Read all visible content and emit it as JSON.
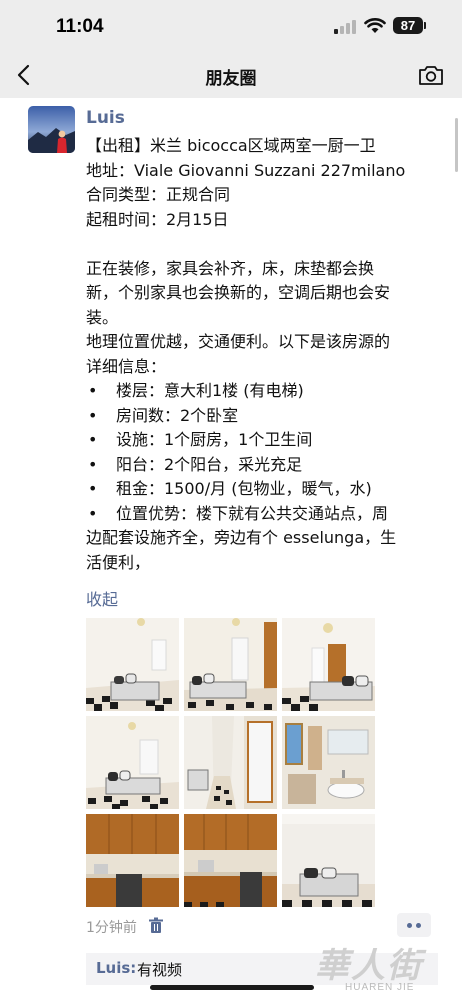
{
  "status": {
    "time": "11:04",
    "battery": "87"
  },
  "nav": {
    "title": "朋友圈"
  },
  "post": {
    "username": "Luis",
    "lines": [
      "【出租】米兰 bicocca区域两室一厨一卫",
      "地址：Viale Giovanni Suzzani 227milano",
      "合同类型：正规合同",
      "起租时间：2月15日",
      "",
      "正在装修，家具会补齐，床，床垫都会换",
      "新，个别家具也会换新的，空调后期也会安",
      "装。",
      "地理位置优越，交通便利。以下是该房源的",
      "详细信息："
    ],
    "bullet_char": "•",
    "bullets": [
      "楼层：意大利1楼 (有电梯)",
      "房间数：2个卧室",
      "设施：1个厨房，1个卫生间",
      "阳台：2个阳台，采光充足",
      "租金：1500/月 (包物业，暖气，水)",
      "位置优势：楼下就有公共交通站点，周"
    ],
    "tail_lines": [
      "边配套设施齐全，旁边有个 esselunga，生",
      "活便利，"
    ],
    "collapse_label": "收起",
    "photos": [
      {
        "subject": "bedroom-checkered-floor-bed"
      },
      {
        "subject": "bedroom-bed-wardrobe"
      },
      {
        "subject": "bedroom-door-bed"
      },
      {
        "subject": "bedroom-window-bed"
      },
      {
        "subject": "hallway"
      },
      {
        "subject": "bathroom"
      },
      {
        "subject": "kitchen"
      },
      {
        "subject": "kitchen-counter"
      },
      {
        "subject": "bedroom-bed"
      }
    ],
    "timestamp": "1分钟前",
    "comment": {
      "user": "Luis:",
      "text": "有视频"
    }
  },
  "watermark": {
    "main": "華人街",
    "sub": "HUAREN JIE"
  },
  "colors": {
    "link": "#576b95",
    "header_bg": "#ededed",
    "floor_dark": "#1b1b1b",
    "wood": "#b5702a"
  }
}
